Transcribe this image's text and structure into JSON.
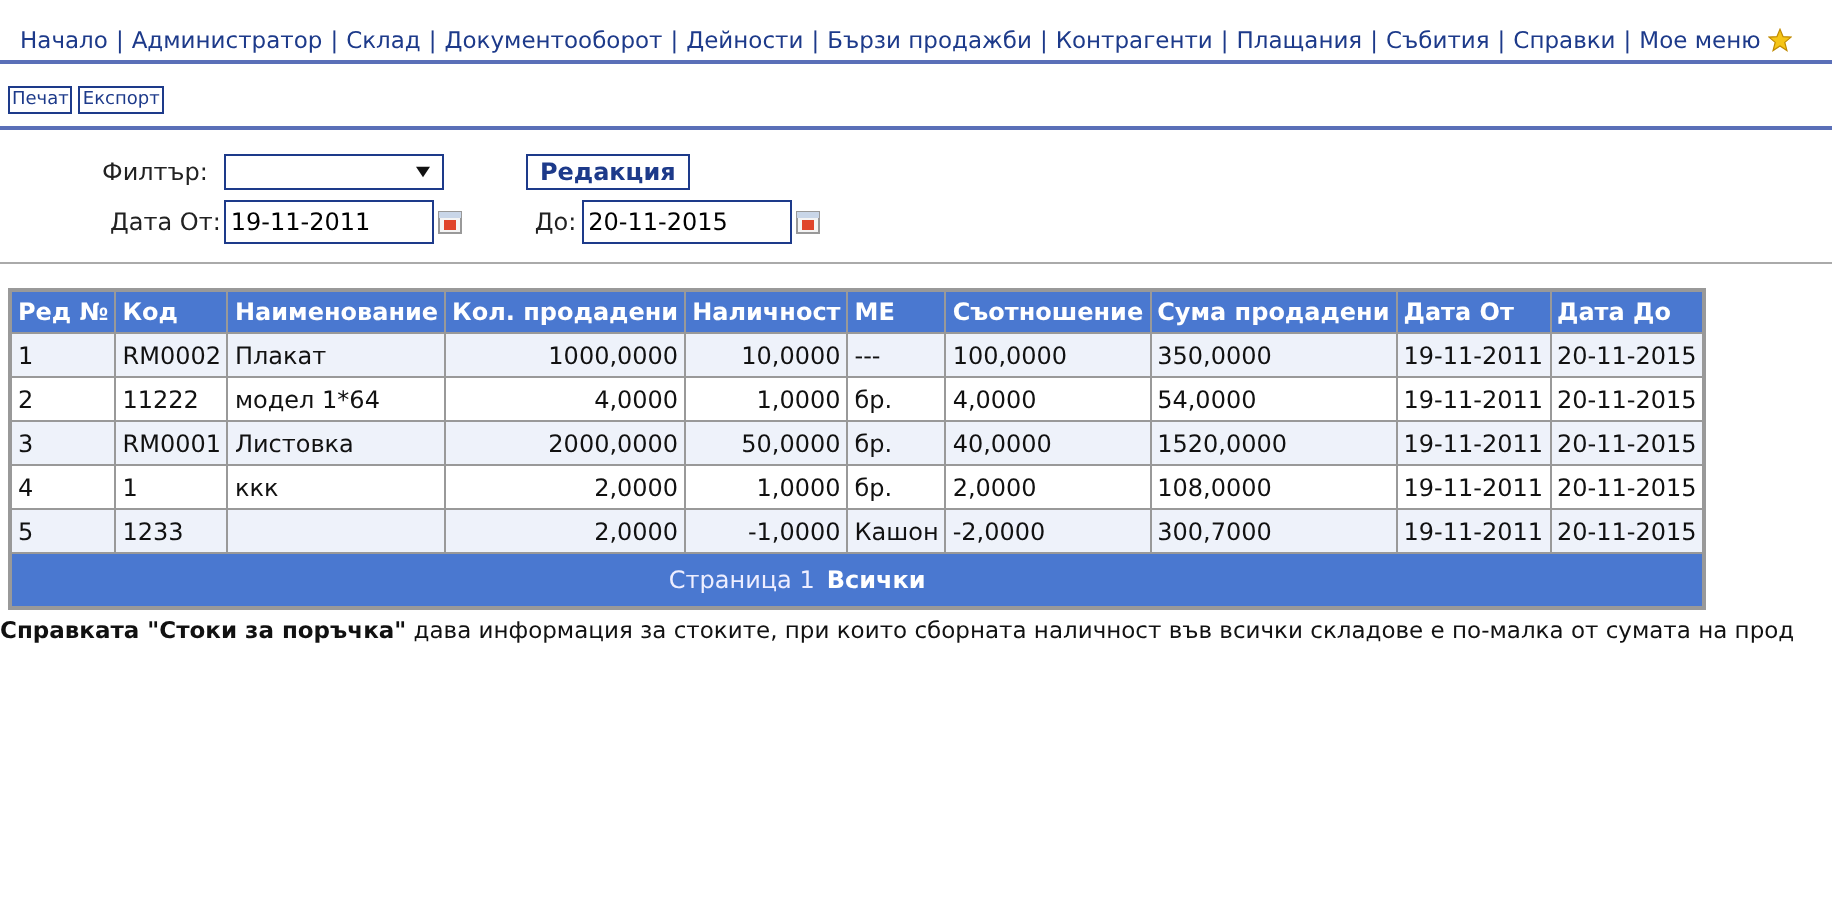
{
  "nav": {
    "separator": "|",
    "items": [
      "Начало",
      "Администратор",
      "Склад",
      "Документооборот",
      "Дейности",
      "Бързи продажби",
      "Контрагенти",
      "Плащания",
      "Събития",
      "Справки",
      "Мое меню"
    ]
  },
  "toolbar": [
    "Печат",
    "Експорт"
  ],
  "filter": {
    "label": "Филтър:",
    "button": "Редакция"
  },
  "dates": {
    "from_label": "Дата От:",
    "from": "19-11-2011",
    "to_label": "До:",
    "to": "20-11-2015"
  },
  "table": {
    "columns": [
      "Ред №",
      "Код",
      "Наименование",
      "Кол. продадени",
      "Наличност",
      "МЕ",
      "Съотношение",
      "Сума продадени",
      "Дата От",
      "Дата До"
    ],
    "rows": [
      [
        "1",
        "RM0002",
        "Плакат",
        "1000,0000",
        "10,0000",
        "---",
        "100,0000",
        "350,0000",
        "19-11-2011",
        "20-11-2015"
      ],
      [
        "2",
        "11222",
        "модел 1*64",
        "4,0000",
        "1,0000",
        "бр.",
        "4,0000",
        "54,0000",
        "19-11-2011",
        "20-11-2015"
      ],
      [
        "3",
        "RM0001",
        "Листовка",
        "2000,0000",
        "50,0000",
        "бр.",
        "40,0000",
        "1520,0000",
        "19-11-2011",
        "20-11-2015"
      ],
      [
        "4",
        "1",
        "ккк",
        "2,0000",
        "1,0000",
        "бр.",
        "2,0000",
        "108,0000",
        "19-11-2011",
        "20-11-2015"
      ],
      [
        "5",
        "1233",
        "",
        "2,0000",
        "-1,0000",
        "Кашон",
        "-2,0000",
        "300,7000",
        "19-11-2011",
        "20-11-2015"
      ]
    ],
    "pager": {
      "label": "Страница 1",
      "all": "Всички"
    }
  },
  "description": "**Справката \"Стоки за поръчка\"** дава информация за стоките, при които сборната наличност във всички складове е по-малка от сумата на прод"
}
